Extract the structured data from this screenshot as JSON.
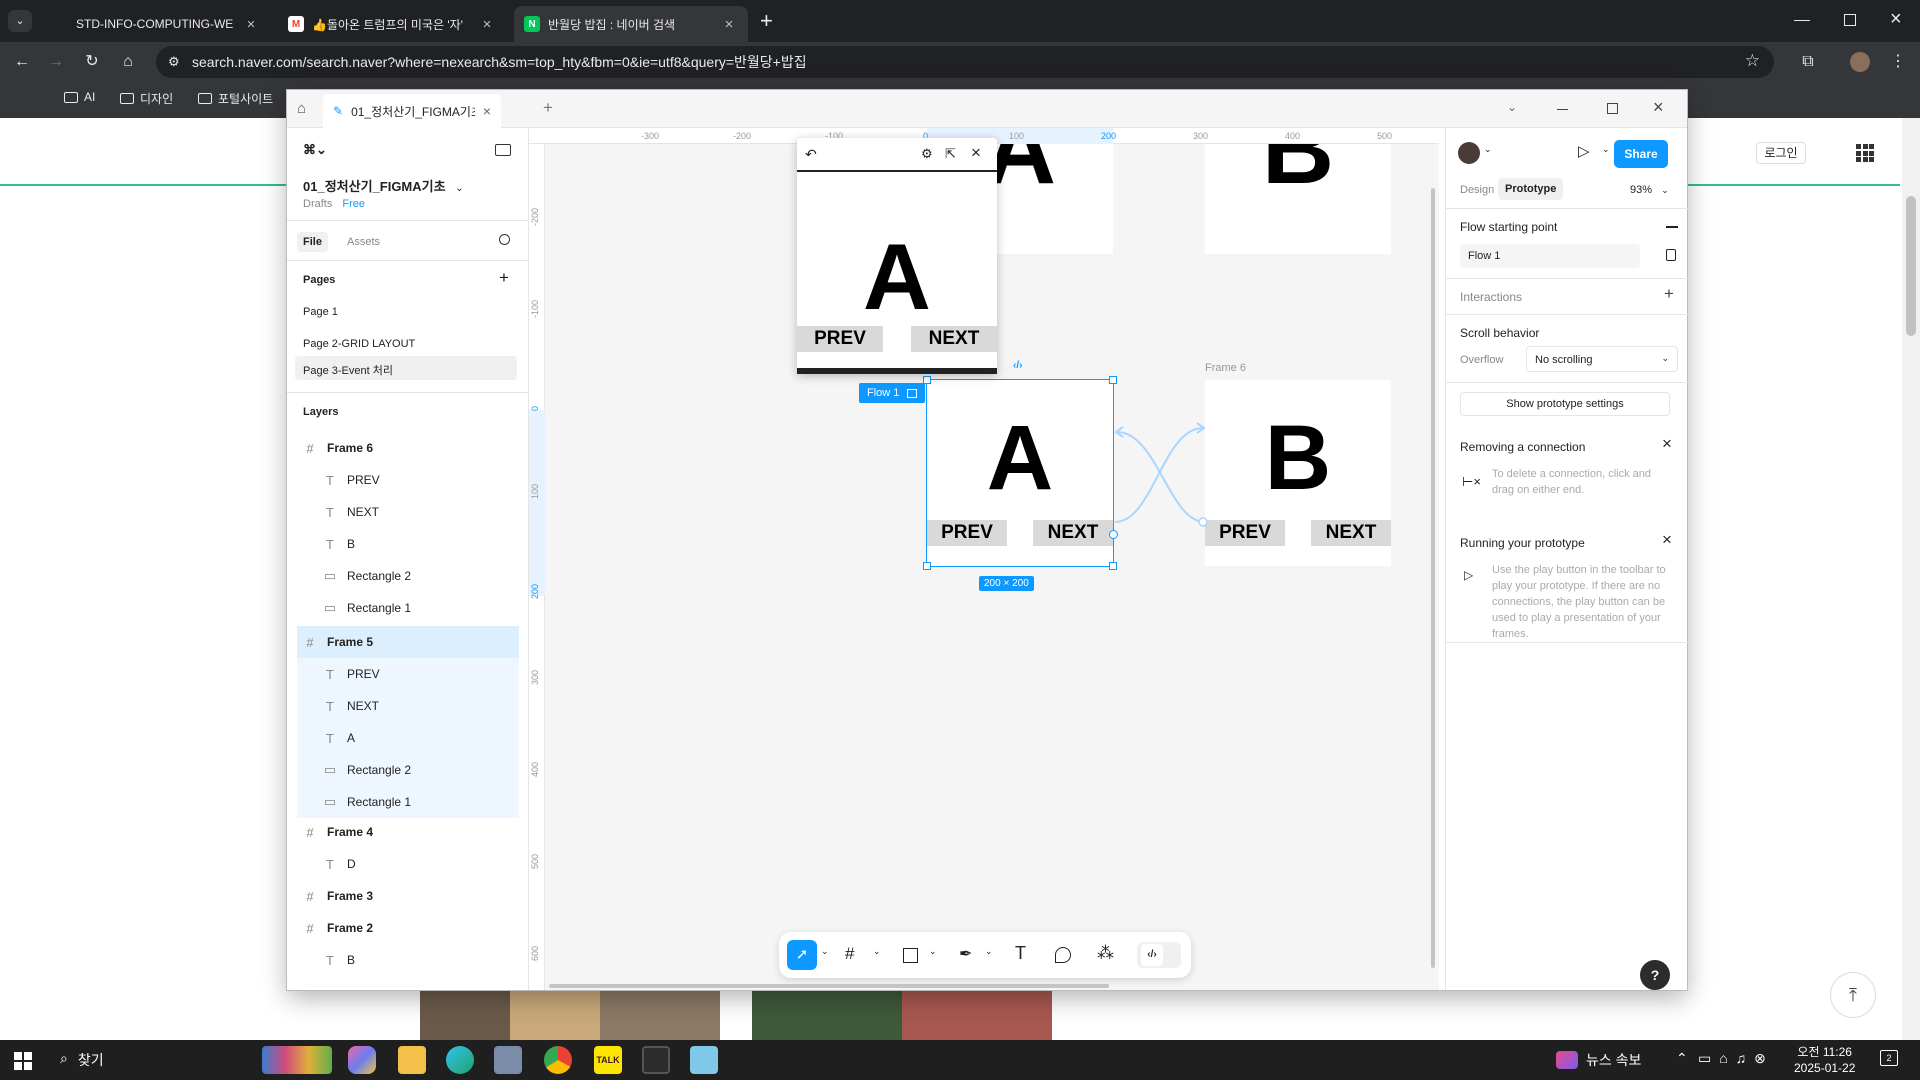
{
  "browser": {
    "tabs": [
      {
        "title": "STD-INFO-COMPUTING-WEB-...",
        "favicon": "doc-icon"
      },
      {
        "title": "👍돌아온 트럼프의 미국은 '자'",
        "favicon": "gmail-icon"
      },
      {
        "title": "반월당 밥집 : 네이버 검색",
        "favicon": "naver-icon"
      }
    ],
    "url": "search.naver.com/search.naver?where=nexearch&sm=top_hty&fbm=0&ie=utf8&query=반월당+밥집",
    "bookmarks": [
      "AI",
      "디자인",
      "포털사이트"
    ]
  },
  "naver": {
    "login": "로그인"
  },
  "figma": {
    "tab_title": "01_정처산기_FIGMA기초",
    "file_name": "01_정처산기_FIGMA기초",
    "drafts": "Drafts",
    "plan": "Free",
    "left_tabs": {
      "file": "File",
      "assets": "Assets"
    },
    "pages_title": "Pages",
    "pages": [
      "Page 1",
      "Page 2-GRID LAYOUT",
      "Page 3-Event 처리"
    ],
    "layers_title": "Layers",
    "layers": [
      {
        "name": "Frame 6",
        "type": "frame"
      },
      {
        "name": "PREV",
        "type": "text"
      },
      {
        "name": "NEXT",
        "type": "text"
      },
      {
        "name": "B",
        "type": "text"
      },
      {
        "name": "Rectangle 2",
        "type": "rect"
      },
      {
        "name": "Rectangle 1",
        "type": "rect"
      },
      {
        "name": "Frame 5",
        "type": "frame"
      },
      {
        "name": "PREV",
        "type": "text"
      },
      {
        "name": "NEXT",
        "type": "text"
      },
      {
        "name": "A",
        "type": "text"
      },
      {
        "name": "Rectangle 2",
        "type": "rect"
      },
      {
        "name": "Rectangle 1",
        "type": "rect"
      },
      {
        "name": "Frame 4",
        "type": "frame"
      },
      {
        "name": "D",
        "type": "text"
      },
      {
        "name": "Frame 3",
        "type": "frame"
      },
      {
        "name": "Frame 2",
        "type": "frame"
      },
      {
        "name": "B",
        "type": "text"
      }
    ],
    "ruler_top": [
      "-300",
      "-200",
      "-100",
      "0",
      "100",
      "200",
      "300",
      "400",
      "500"
    ],
    "ruler_left": [
      "-200",
      "-100",
      "0",
      "100",
      "200",
      "300",
      "400",
      "500",
      "600"
    ],
    "canvas": {
      "frame6_label": "Frame 6",
      "flow_label": "Flow 1",
      "size_badge": "200 × 200",
      "letter_a": "A",
      "letter_b": "B",
      "prev": "PREV",
      "next": "NEXT"
    },
    "preview": {
      "letter": "A",
      "prev": "PREV",
      "next": "NEXT"
    },
    "right": {
      "tab_design": "Design",
      "tab_prototype": "Prototype",
      "zoom": "93%",
      "share": "Share",
      "flow_start_title": "Flow starting point",
      "flow_name": "Flow 1",
      "interactions": "Interactions",
      "scroll_title": "Scroll behavior",
      "overflow_label": "Overflow",
      "overflow_value": "No scrolling",
      "show_settings": "Show prototype settings",
      "removing_title": "Removing a connection",
      "removing_text": "To delete a connection, click and drag on either end.",
      "running_title": "Running your prototype",
      "running_text": "Use the play button in the toolbar to play your prototype. If there are no connections, the play button can be used to play a presentation of your frames.",
      "help": "?"
    }
  },
  "taskbar": {
    "search": "찾기",
    "news": "뉴스 속보",
    "time": "오전 11:26",
    "date": "2025-01-22",
    "notif": "2"
  },
  "colors": {
    "figma_blue": "#0d99ff",
    "chrome_dark": "#202124",
    "naver_green": "#03c75a"
  }
}
